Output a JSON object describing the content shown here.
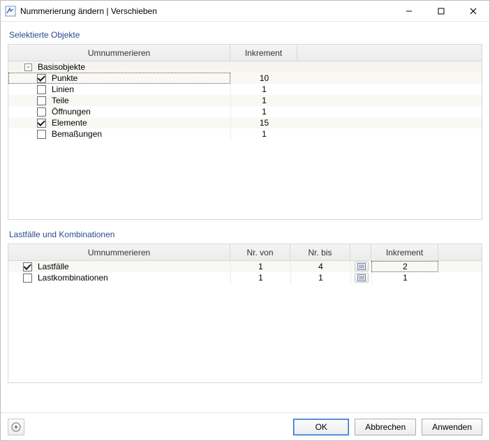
{
  "window": {
    "title": "Nummerierung ändern | Verschieben"
  },
  "section1": {
    "title": "Selektierte Objekte",
    "headers": {
      "col_name": "Umnummerieren",
      "col_inc": "Inkrement"
    },
    "parent_label": "Basisobjekte",
    "rows": [
      {
        "label": "Punkte",
        "checked": true,
        "inc": "10"
      },
      {
        "label": "Linien",
        "checked": false,
        "inc": "1"
      },
      {
        "label": "Teile",
        "checked": false,
        "inc": "1"
      },
      {
        "label": "Öffnungen",
        "checked": false,
        "inc": "1"
      },
      {
        "label": "Elemente",
        "checked": true,
        "inc": "15"
      },
      {
        "label": "Bemaßungen",
        "checked": false,
        "inc": "1"
      }
    ]
  },
  "section2": {
    "title": "Lastfälle und Kombinationen",
    "headers": {
      "col_name": "Umnummerieren",
      "col_from": "Nr. von",
      "col_to": "Nr. bis",
      "col_inc": "Inkrement"
    },
    "rows": [
      {
        "label": "Lastfälle",
        "checked": true,
        "from": "1",
        "to": "4",
        "inc": "2"
      },
      {
        "label": "Lastkombinationen",
        "checked": false,
        "from": "1",
        "to": "1",
        "inc": "1"
      }
    ]
  },
  "buttons": {
    "ok": "OK",
    "cancel": "Abbrechen",
    "apply": "Anwenden"
  }
}
